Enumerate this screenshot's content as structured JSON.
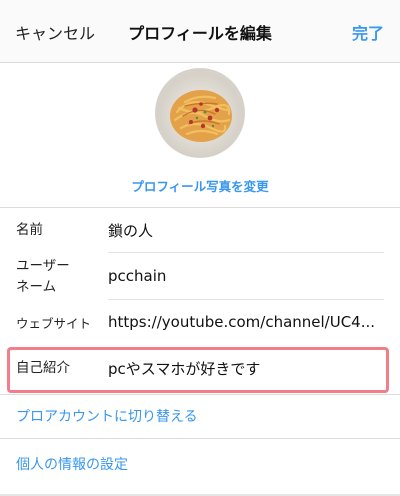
{
  "navbar": {
    "cancel_label": "キャンセル",
    "title": "プロフィールを編集",
    "done_label": "完了"
  },
  "profile_photo": {
    "change_label": "プロフィール写真を変更"
  },
  "form": {
    "name_label": "名前",
    "name_value": "鎖の人",
    "username_label": "ユーザー\nネーム",
    "username_value": "pcchain",
    "website_label": "ウェブサイト",
    "website_value": "https://youtube.com/channel/UC4...",
    "bio_label": "自己紹介",
    "bio_value": "pcやスマホが好きです"
  },
  "links": {
    "switch_pro": "プロアカウントに切り替える",
    "personal_info": "個人の情報の設定"
  },
  "colors": {
    "accent": "#3897f0",
    "highlight": "#f07f8b"
  }
}
